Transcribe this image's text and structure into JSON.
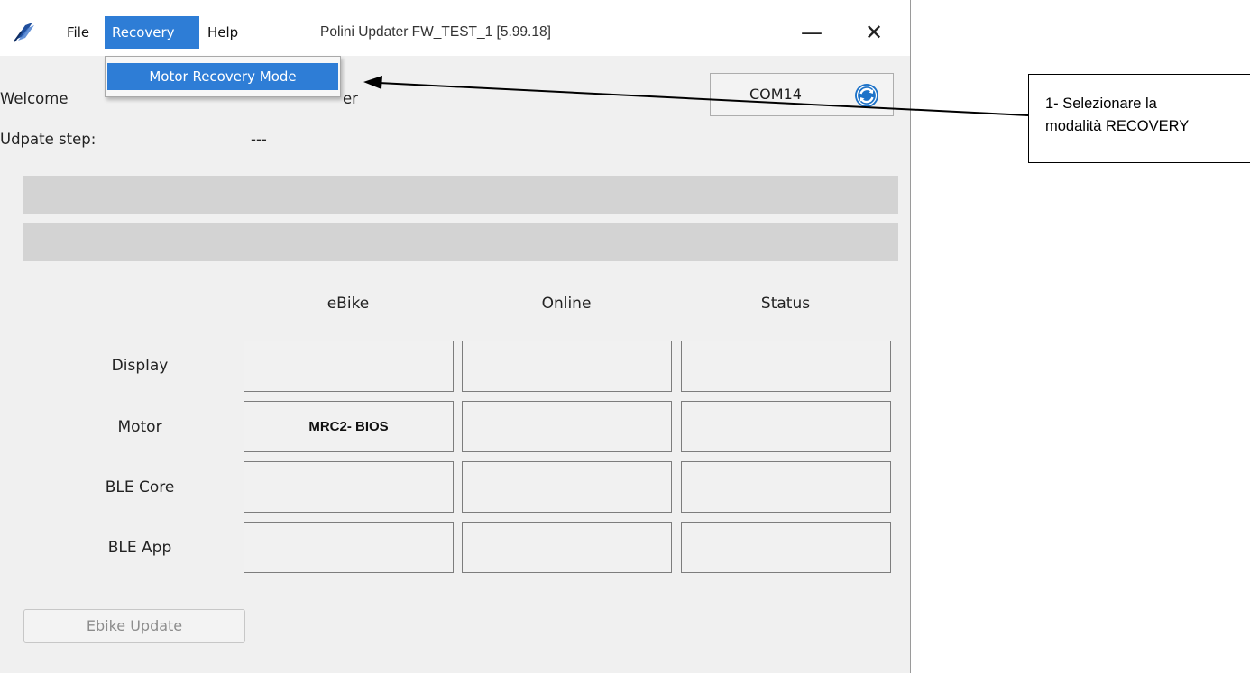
{
  "menu": {
    "file": "File",
    "recovery": "Recovery",
    "help": "Help"
  },
  "window": {
    "title": "Polini Updater FW_TEST_1 [5.99.18]",
    "minimize_glyph": "—",
    "close_glyph": "✕"
  },
  "recovery_menu": {
    "items": [
      "Motor Recovery Mode"
    ]
  },
  "welcome": {
    "left": "Welcome",
    "right": "er"
  },
  "update_step": {
    "label": "Udpate step:",
    "value": "---"
  },
  "port": {
    "value": "COM14",
    "refresh_icon": "refresh-icon"
  },
  "progress": {
    "bar1": 0,
    "bar2": 0
  },
  "table": {
    "columns": [
      "eBike",
      "Online",
      "Status"
    ],
    "rows": [
      {
        "label": "Display",
        "cells": [
          "",
          "",
          ""
        ]
      },
      {
        "label": "Motor",
        "cells": [
          "MRC2- BIOS",
          "",
          ""
        ]
      },
      {
        "label": "BLE Core",
        "cells": [
          "",
          "",
          ""
        ]
      },
      {
        "label": "BLE App",
        "cells": [
          "",
          "",
          ""
        ]
      }
    ]
  },
  "buttons": {
    "ebike_update": "Ebike Update"
  },
  "annotation": {
    "line1": "1- Selezionare la",
    "line2": "modalità RECOVERY"
  },
  "colors": {
    "menu_highlight": "#2e7dd6",
    "window_bg": "#f0f0f0",
    "progress_track": "#d3d3d3",
    "refresh_icon": "#1d72c8"
  }
}
